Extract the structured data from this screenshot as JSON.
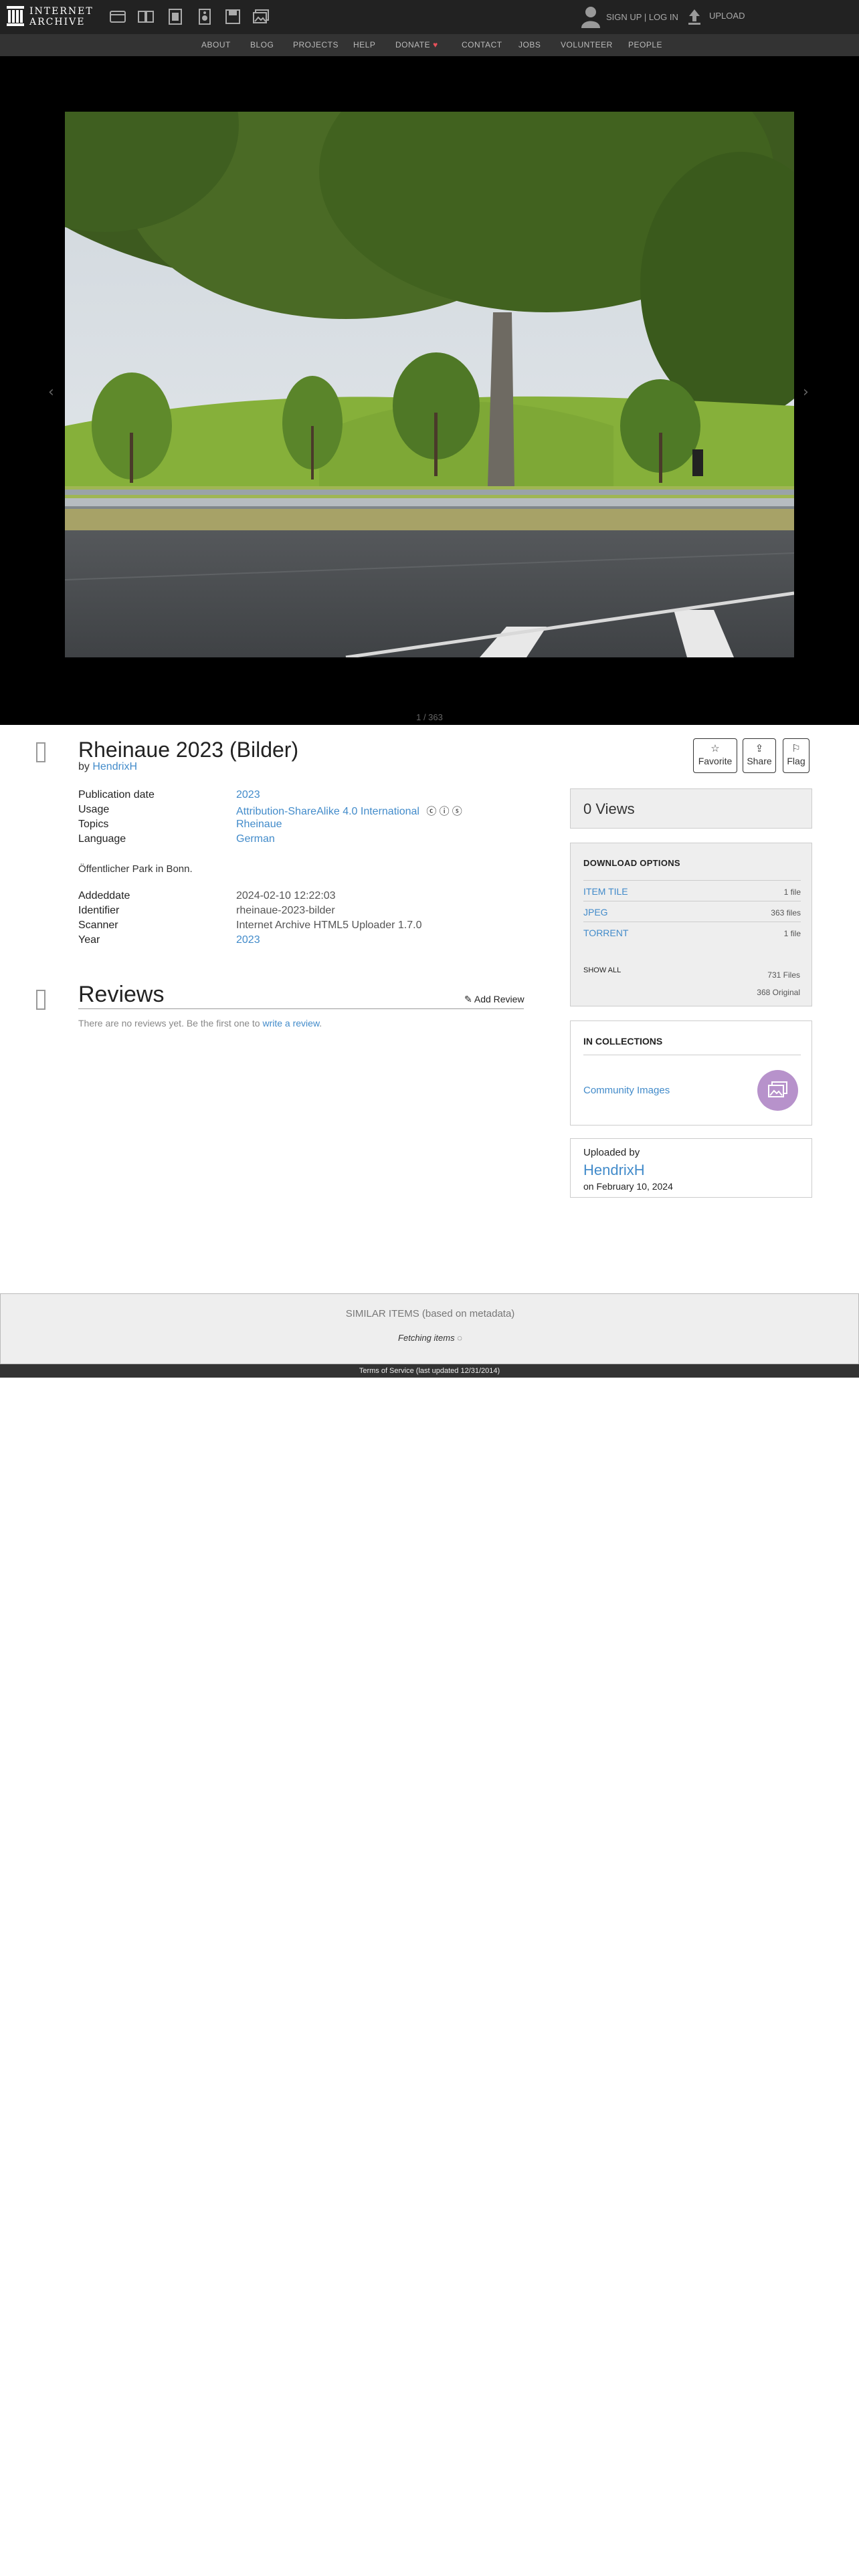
{
  "topnav": {
    "logo_line1": "INTERNET",
    "logo_line2": "ARCHIVE",
    "media_icons": [
      "web-icon",
      "texts-icon",
      "video-icon",
      "audio-icon",
      "software-icon",
      "images-icon"
    ],
    "signup_label": "SIGN UP | LOG IN",
    "upload_label": "UPLOAD"
  },
  "subnav": {
    "items": [
      "ABOUT",
      "BLOG",
      "PROJECTS",
      "HELP",
      "DONATE",
      "CONTACT",
      "JOBS",
      "VOLUNTEER",
      "PEOPLE"
    ]
  },
  "viewer": {
    "prev_arrow": "‹",
    "next_arrow": "›",
    "page_count": "1 / 363"
  },
  "item": {
    "title": "Rheinaue 2023 (Bilder)",
    "by_prefix": "by ",
    "author": "HendrixH",
    "actions": {
      "favorite": "Favorite",
      "share": "Share",
      "flag": "Flag"
    },
    "metadata_top": [
      {
        "key": "Publication date",
        "value": "2023"
      },
      {
        "key": "Usage",
        "value": "Attribution-ShareAlike 4.0 International"
      },
      {
        "key": "Topics",
        "value": "Rheinaue"
      },
      {
        "key": "Language",
        "value": "German"
      }
    ],
    "description": "Öffentlicher Park in Bonn.",
    "metadata_bottom": [
      {
        "key": "Addeddate",
        "value": "2024-02-10 12:22:03"
      },
      {
        "key": "Identifier",
        "value": "rheinaue-2023-bilder"
      },
      {
        "key": "Scanner",
        "value": "Internet Archive HTML5 Uploader 1.7.0"
      },
      {
        "key": "Year",
        "value": "2023"
      }
    ]
  },
  "reviews": {
    "heading": "Reviews",
    "add_label": "Add Review",
    "none_text": "There are no reviews yet. Be the first one to ",
    "none_link": "write a review",
    "none_end": "."
  },
  "sidebar": {
    "views": "0 Views",
    "download": {
      "heading": "DOWNLOAD OPTIONS",
      "rows": [
        {
          "label": "ITEM TILE",
          "count": "1 file"
        },
        {
          "label": "JPEG",
          "count": "363 files"
        },
        {
          "label": "TORRENT",
          "count": "1 file"
        }
      ],
      "show_all": "SHOW ALL",
      "total_files": "731 Files",
      "total_original": "368 Original"
    },
    "collections": {
      "heading": "IN COLLECTIONS",
      "item": "Community Images"
    },
    "uploaded": {
      "label": "Uploaded by",
      "name": "HendrixH",
      "date": "on February 10, 2024"
    }
  },
  "similar": {
    "heading": "SIMILAR ITEMS (based on metadata)",
    "fetching": "Fetching items"
  },
  "footer": {
    "text": "Terms of Service (last updated 12/31/2014)"
  }
}
